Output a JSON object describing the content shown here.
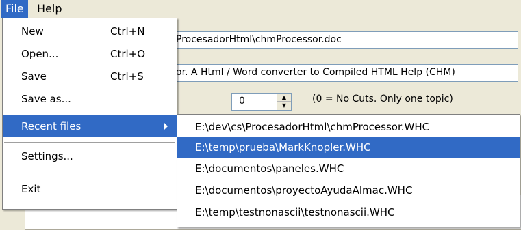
{
  "menubar": {
    "file": "File",
    "help": "Help"
  },
  "background": {
    "field1_value": "ProcesadorHtml\\chmProcessor.doc",
    "field2_value": "or. A Html / Word converter to Compiled HTML Help (CHM)",
    "cuts_value": "0",
    "cuts_note": "(0 = No Cuts. Only one topic)"
  },
  "file_menu": {
    "items": [
      {
        "label": "New",
        "shortcut": "Ctrl+N"
      },
      {
        "label": "Open...",
        "shortcut": "Ctrl+O"
      },
      {
        "label": "Save",
        "shortcut": "Ctrl+S"
      },
      {
        "label": "Save as...",
        "shortcut": ""
      },
      {
        "label": "Recent files",
        "shortcut": ""
      },
      {
        "label": "Settings...",
        "shortcut": ""
      },
      {
        "label": "Exit",
        "shortcut": ""
      }
    ]
  },
  "recent_files": {
    "items": [
      "E:\\dev\\cs\\ProcesadorHtml\\chmProcessor.WHC",
      "E:\\temp\\prueba\\MarkKnopler.WHC",
      "E:\\documentos\\paneles.WHC",
      "E:\\documentos\\proyectoAyudaAlmac.WHC",
      "E:\\temp\\testnonascii\\testnonascii.WHC"
    ]
  },
  "colors": {
    "highlight": "#316ac5",
    "window_bg": "#ece9d8"
  }
}
